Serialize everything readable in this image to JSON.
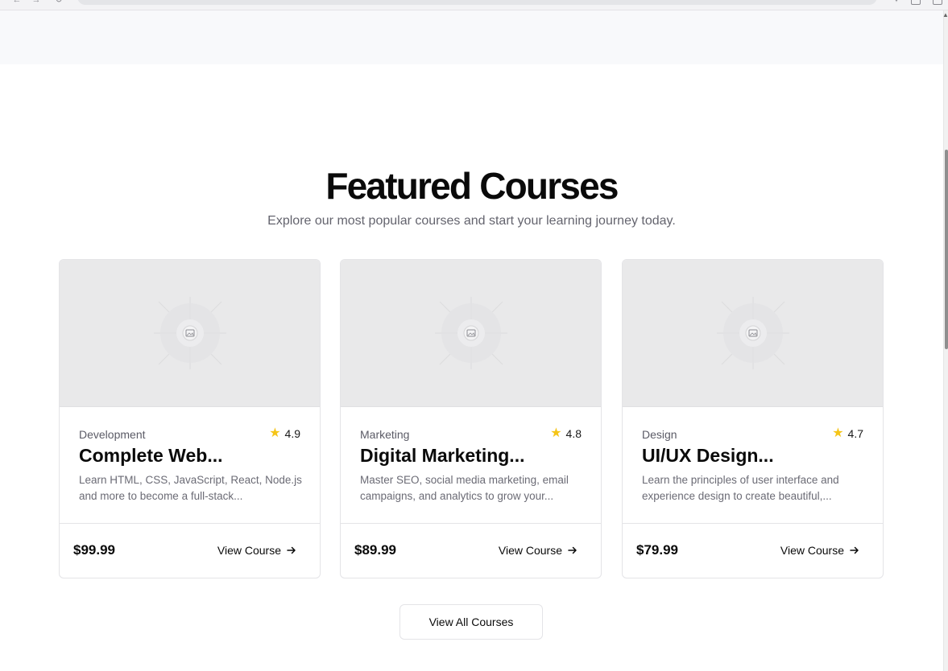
{
  "section": {
    "title": "Featured Courses",
    "subtitle": "Explore our most popular courses and start your learning journey today."
  },
  "courses": [
    {
      "category": "Development",
      "rating": "4.9",
      "title": "Complete Web...",
      "description": "Learn HTML, CSS, JavaScript, React, Node.js and more to become a full-stack...",
      "price": "$99.99",
      "cta": "View Course"
    },
    {
      "category": "Marketing",
      "rating": "4.8",
      "title": "Digital Marketing...",
      "description": "Master SEO, social media marketing, email campaigns, and analytics to grow your...",
      "price": "$89.99",
      "cta": "View Course"
    },
    {
      "category": "Design",
      "rating": "4.7",
      "title": "UI/UX Design...",
      "description": "Learn the principles of user interface and experience design to create beautiful,...",
      "price": "$79.99",
      "cta": "View Course"
    }
  ],
  "view_all_label": "View All Courses",
  "icons": {
    "star": "star-icon",
    "arrow": "arrow-right-icon",
    "placeholder": "image-placeholder-icon"
  },
  "colors": {
    "star": "#f5c518",
    "muted_text": "#64646e",
    "border": "#e4e4e7",
    "thumbnail_bg": "#e9e9ea"
  }
}
